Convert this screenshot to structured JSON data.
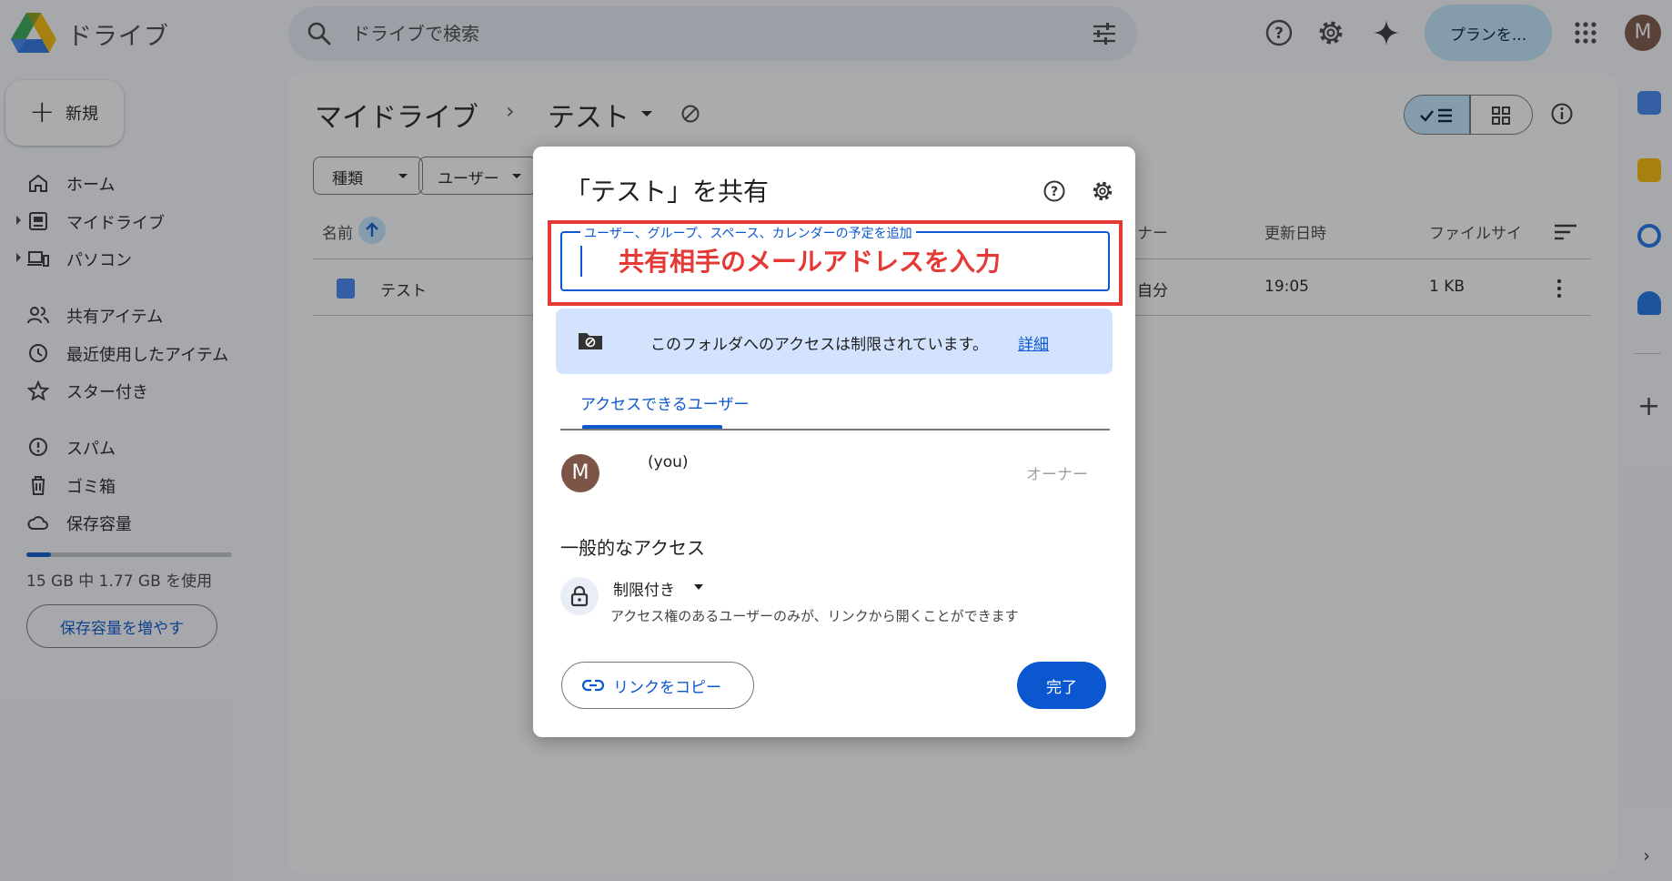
{
  "app": {
    "title": "ドライブ"
  },
  "search": {
    "placeholder": "ドライブで検索"
  },
  "header": {
    "plan_label": "プランを...",
    "avatar_letter": "M"
  },
  "sidebar": {
    "new_label": "新規",
    "items": [
      {
        "label": "ホーム",
        "icon": "home-icon"
      },
      {
        "label": "マイドライブ",
        "icon": "drive-icon"
      },
      {
        "label": "パソコン",
        "icon": "computer-icon"
      },
      {
        "label": "共有アイテム",
        "icon": "people-icon"
      },
      {
        "label": "最近使用したアイテム",
        "icon": "clock-icon"
      },
      {
        "label": "スター付き",
        "icon": "star-icon"
      },
      {
        "label": "スパム",
        "icon": "spam-icon"
      },
      {
        "label": "ゴミ箱",
        "icon": "trash-icon"
      },
      {
        "label": "保存容量",
        "icon": "cloud-icon"
      }
    ],
    "storage_text": "15 GB 中 1.77 GB を使用",
    "storage_fraction": 0.118,
    "storage_button": "保存容量を増やす"
  },
  "main": {
    "breadcrumb_root": "マイドライブ",
    "breadcrumb_sep": "›",
    "breadcrumb_current": "テスト",
    "filters": [
      "種類",
      "ユーザー"
    ],
    "columns": {
      "name": "名前",
      "owner": "ナー",
      "modified": "更新日時",
      "size": "ファイルサイ"
    },
    "rows": [
      {
        "name": "テスト",
        "owner": "自分",
        "modified": "19:05",
        "size": "1 KB"
      }
    ]
  },
  "dialog": {
    "title": "「テスト」を共有",
    "field_label": "ユーザー、グループ、スペース、カレンダーの予定を追加",
    "annotation": "共有相手のメールアドレスを入力",
    "banner_text": "このフォルダへのアクセスは制限されています。",
    "banner_link": "詳細",
    "tab_label": "アクセスできるユーザー",
    "user": {
      "avatar_letter": "M",
      "name": "(you)",
      "role": "オーナー"
    },
    "general_access_title": "一般的なアクセス",
    "access_level": "制限付き",
    "access_description": "アクセス権のあるユーザーのみが、リンクから開くことができます",
    "copy_link_label": "リンクをコピー",
    "done_label": "完了"
  },
  "colors": {
    "accent": "#0b57d0",
    "annotation_red": "#e53935",
    "banner_bg": "#d3e3fd"
  }
}
